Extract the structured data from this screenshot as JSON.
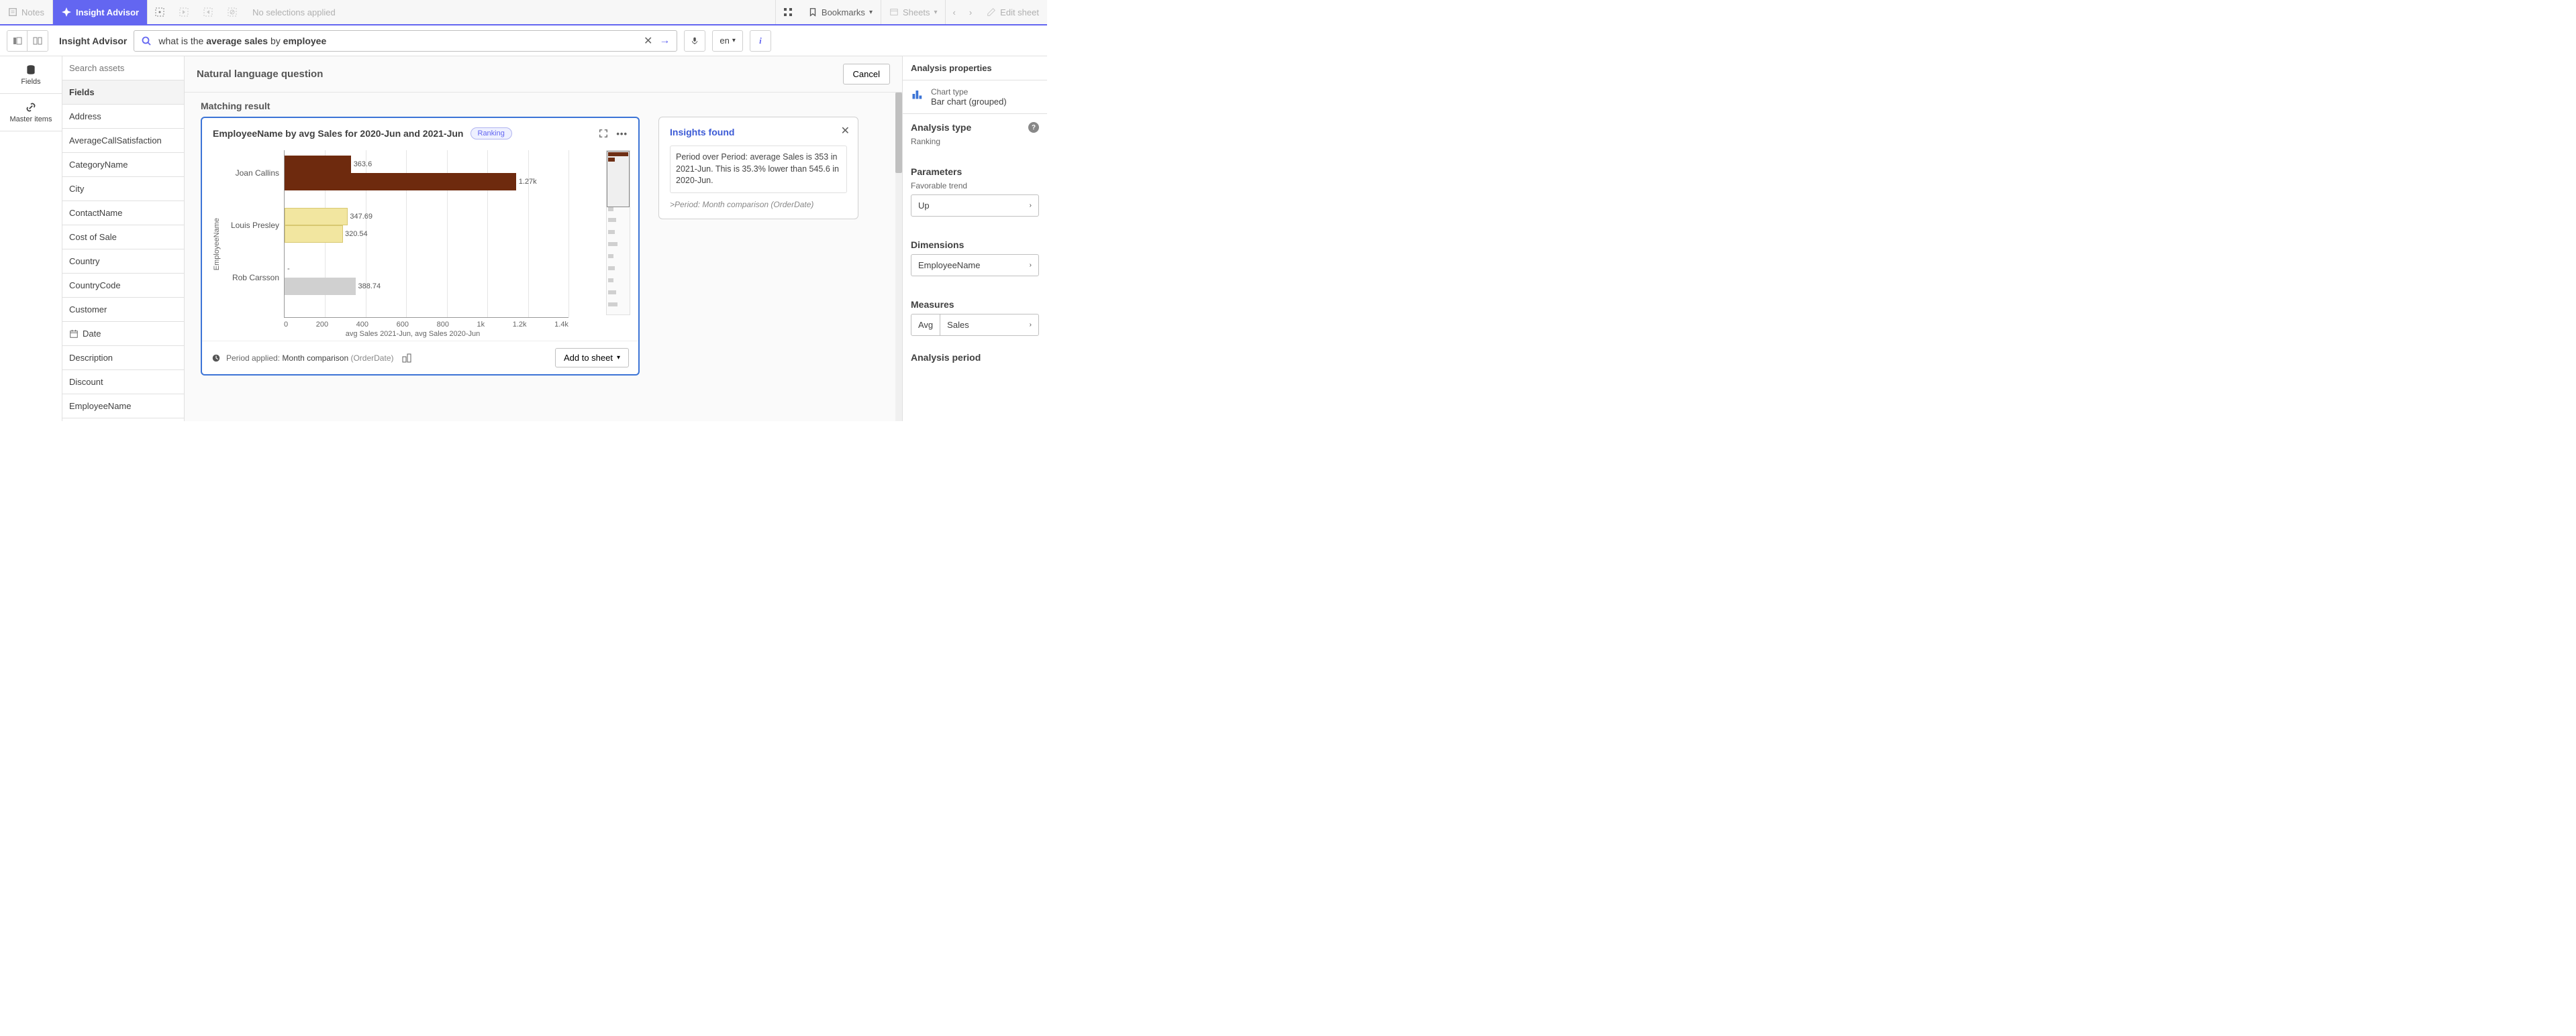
{
  "topbar": {
    "notes": "Notes",
    "insight_advisor": "Insight Advisor",
    "no_selections": "No selections applied",
    "bookmarks": "Bookmarks",
    "sheets": "Sheets",
    "edit_sheet": "Edit sheet"
  },
  "subbar": {
    "title": "Insight Advisor",
    "query_prefix": "what is the ",
    "query_bold1": "average sales",
    "query_mid": " by ",
    "query_bold2": "employee",
    "lang": "en"
  },
  "leftnav": {
    "fields": "Fields",
    "master": "Master items"
  },
  "assets": {
    "search_placeholder": "Search assets",
    "header": "Fields",
    "items": [
      "Address",
      "AverageCallSatisfaction",
      "CategoryName",
      "City",
      "ContactName",
      "Cost of Sale",
      "Country",
      "CountryCode",
      "Customer",
      "Date",
      "Description",
      "Discount",
      "EmployeeName"
    ],
    "date_index": 9
  },
  "content": {
    "nlq_title": "Natural language question",
    "cancel": "Cancel",
    "matching": "Matching result"
  },
  "card": {
    "title": "EmployeeName by avg Sales for 2020-Jun and 2021-Jun",
    "badge": "Ranking",
    "y_axis": "EmployeeName",
    "x_label": "avg Sales 2021-Jun, avg Sales 2020-Jun",
    "period_applied_label": "Period applied:",
    "period_applied_main": "Month comparison",
    "period_applied_paren": "(OrderDate)",
    "add_to_sheet": "Add to sheet",
    "x_ticks": [
      "0",
      "200",
      "400",
      "600",
      "800",
      "1k",
      "1.2k",
      "1.4k"
    ]
  },
  "insights": {
    "title": "Insights found",
    "body": "Period over Period: average Sales is 353 in 2021-Jun. This is 35.3% lower than 545.6 in 2020-Jun.",
    "note": ">Period: Month comparison (OrderDate)"
  },
  "rp": {
    "header": "Analysis properties",
    "chart_type_label": "Chart type",
    "chart_type_value": "Bar chart (grouped)",
    "analysis_type_label": "Analysis type",
    "analysis_type_value": "Ranking",
    "parameters_label": "Parameters",
    "favorable_trend_label": "Favorable trend",
    "favorable_trend_value": "Up",
    "dimensions_label": "Dimensions",
    "dimension_value": "EmployeeName",
    "measures_label": "Measures",
    "measure_agg": "Avg",
    "measure_field": "Sales",
    "analysis_period_label": "Analysis period"
  },
  "chart_data": {
    "type": "bar",
    "orientation": "horizontal",
    "grouped": true,
    "categories": [
      "Joan Callins",
      "Louis Presley",
      "Rob Carsson"
    ],
    "series": [
      {
        "name": "avg Sales 2021-Jun",
        "color": "#6e2a0e",
        "values": [
          363.6,
          347.69,
          null
        ],
        "labels": [
          "363.6",
          "347.69",
          "-"
        ]
      },
      {
        "name": "avg Sales 2020-Jun",
        "color_map": [
          "#6e2a0e",
          "#f2e6a0",
          "#d0d0d0"
        ],
        "values": [
          1270,
          320.54,
          388.74
        ],
        "labels": [
          "1.27k",
          "320.54",
          "388.74"
        ]
      }
    ],
    "xlim": [
      0,
      1400
    ],
    "ylabel": "EmployeeName",
    "xlabel": "avg Sales 2021-Jun, avg Sales 2020-Jun",
    "title": "EmployeeName by avg Sales for 2020-Jun and 2021-Jun"
  },
  "minimap": {
    "bars": [
      {
        "top": 2,
        "w": 30,
        "color": "#6e2a0e"
      },
      {
        "top": 10,
        "w": 10,
        "color": "#6e2a0e"
      },
      {
        "top": 84,
        "w": 8,
        "color": "#d0d0d0"
      },
      {
        "top": 100,
        "w": 12,
        "color": "#d0d0d0"
      },
      {
        "top": 118,
        "w": 10,
        "color": "#d0d0d0"
      },
      {
        "top": 136,
        "w": 14,
        "color": "#d0d0d0"
      },
      {
        "top": 154,
        "w": 8,
        "color": "#d0d0d0"
      },
      {
        "top": 172,
        "w": 10,
        "color": "#d0d0d0"
      },
      {
        "top": 190,
        "w": 8,
        "color": "#d0d0d0"
      },
      {
        "top": 208,
        "w": 12,
        "color": "#d0d0d0"
      },
      {
        "top": 226,
        "w": 14,
        "color": "#d0d0d0"
      }
    ]
  }
}
